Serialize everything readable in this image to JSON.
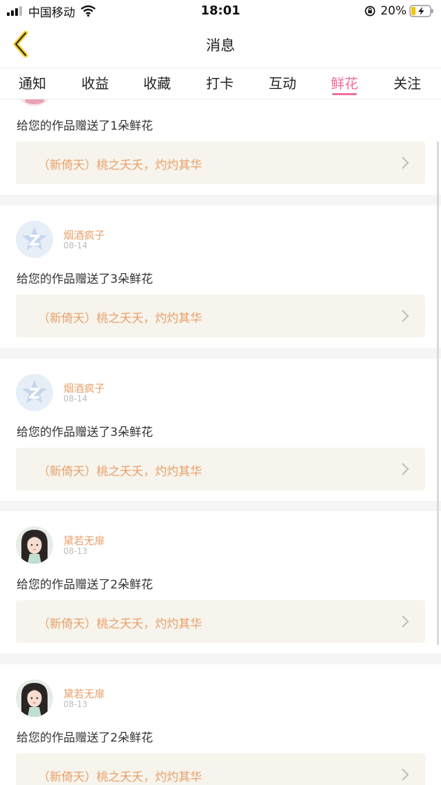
{
  "status_bar": {
    "carrier": "中国移动",
    "time": "18:01",
    "battery_pct": "20%",
    "battery_level": 0.2
  },
  "nav": {
    "title": "消息"
  },
  "tabs": [
    {
      "label": "通知"
    },
    {
      "label": "收益"
    },
    {
      "label": "收藏"
    },
    {
      "label": "打卡"
    },
    {
      "label": "互动"
    },
    {
      "label": "鲜花",
      "active": true
    },
    {
      "label": "关注"
    }
  ],
  "colors": {
    "accent_pink": "#f06e9a",
    "name_orange": "#e8a06a",
    "link_bg": "#f6f4ec"
  },
  "items": [
    {
      "avatar": "pink-avatar-partial",
      "message": "给您的作品赠送了1朵鲜花",
      "work_title": "（新倚天）桃之夭夭，灼灼其华"
    },
    {
      "avatar": "qq-default-avatar",
      "username": "烟酒疯子",
      "date": "08-14",
      "message": "给您的作品赠送了3朵鲜花",
      "work_title": "（新倚天）桃之夭夭，灼灼其华"
    },
    {
      "avatar": "qq-default-avatar",
      "username": "烟酒疯子",
      "date": "08-14",
      "message": "给您的作品赠送了3朵鲜花",
      "work_title": "（新倚天）桃之夭夭，灼灼其华"
    },
    {
      "avatar": "girl-portrait-avatar",
      "username": "黛若无扉",
      "date": "08-13",
      "message": "给您的作品赠送了2朵鲜花",
      "work_title": "（新倚天）桃之夭夭，灼灼其华"
    },
    {
      "avatar": "girl-portrait-avatar",
      "username": "黛若无扉",
      "date": "08-13",
      "message": "给您的作品赠送了2朵鲜花",
      "work_title": "（新倚天）桃之夭夭，灼灼其华"
    }
  ]
}
